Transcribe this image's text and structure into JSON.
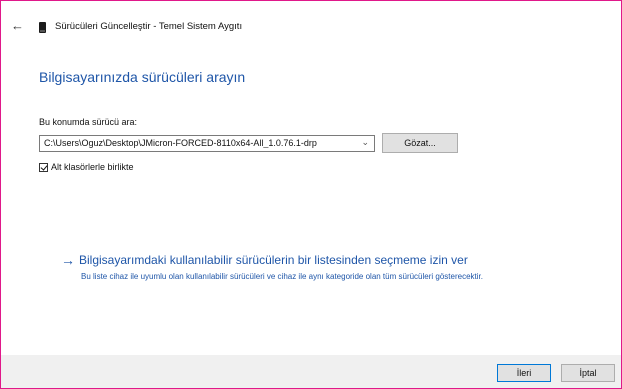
{
  "window": {
    "title": "Sürücüleri Güncelleştir - Temel Sistem Aygıtı",
    "back_icon": "back-arrow-icon",
    "device_icon": "device-icon"
  },
  "main": {
    "heading": "Bilgisayarınızda sürücüleri arayın",
    "path_label": "Bu konumda sürücü ara:",
    "path_value": "C:\\Users\\Oguz\\Desktop\\JMicron-FORCED-8110x64-All_1.0.76.1-drp",
    "browse_label": "Gözat...",
    "include_subfolders_label": "Alt klasörlerle birlikte",
    "include_subfolders_checked": true
  },
  "link": {
    "arrow": "→",
    "title": "Bilgisayarımdaki kullanılabilir sürücülerin bir listesinden seçmeme izin ver",
    "description": "Bu liste cihaz ile uyumlu olan kullanılabilir sürücüleri ve cihaz ile aynı kategoride olan tüm sürücüleri gösterecektir."
  },
  "footer": {
    "next_label": "İleri",
    "cancel_label": "İptal"
  },
  "colors": {
    "accent": "#1f56a8",
    "frame_border": "#e0188a",
    "footer_bg": "#f0f0f0"
  }
}
